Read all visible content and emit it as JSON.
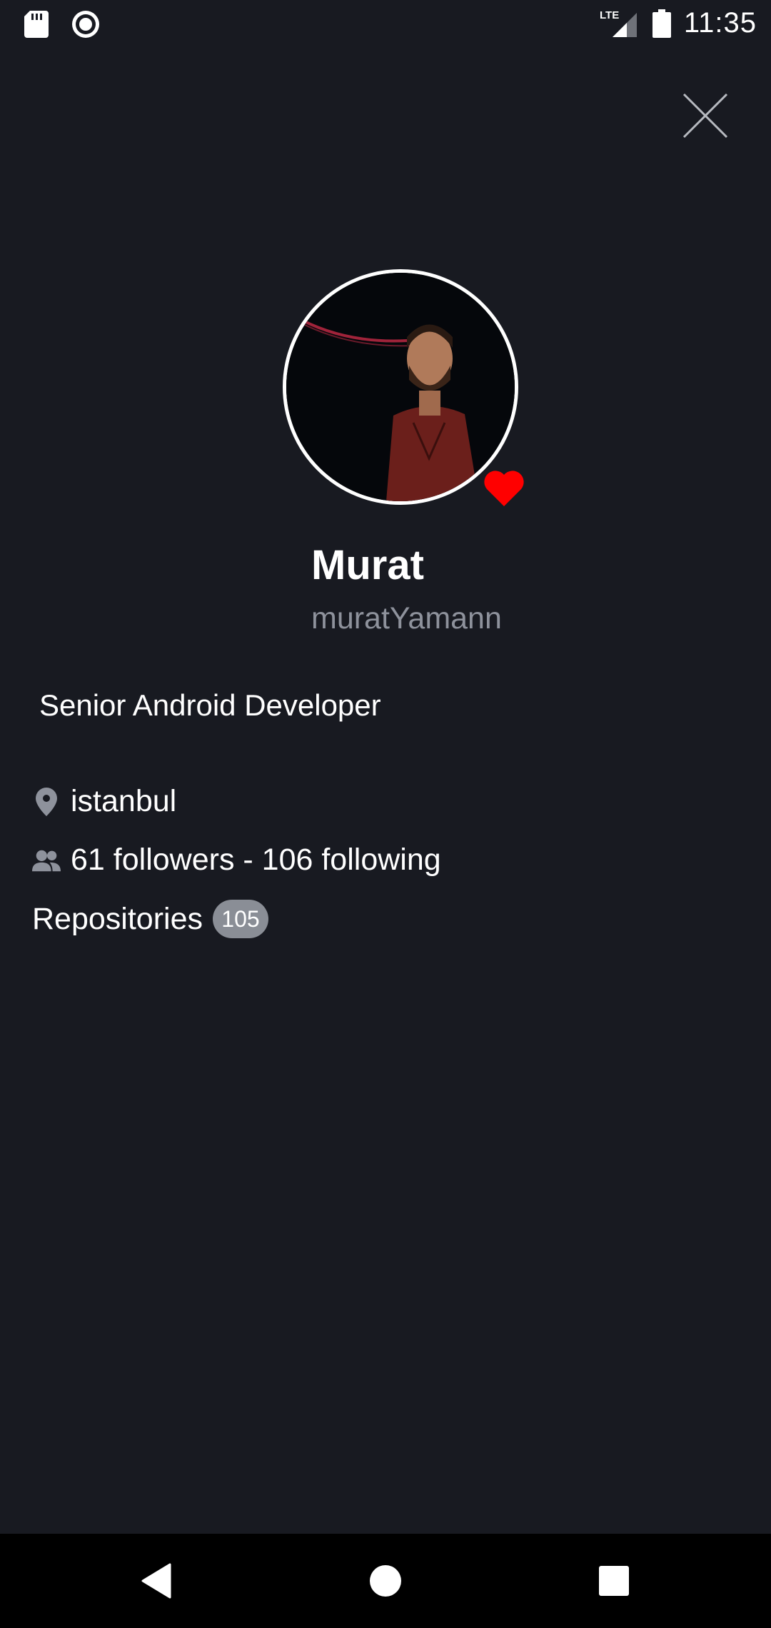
{
  "status_bar": {
    "time": "11:35",
    "network": "LTE",
    "icons": [
      "sd-card-icon",
      "record-icon",
      "lte-signal-icon",
      "battery-icon"
    ]
  },
  "profile": {
    "name": "Murat",
    "username": "muratYamann",
    "bio": "Senior Android Developer",
    "location": "istanbul",
    "follow_text": "61 followers - 106 following",
    "repositories_label": "Repositories",
    "repositories_count": "105"
  },
  "icons": {
    "close": "close-icon",
    "favorite": "heart-icon",
    "location": "location-pin-icon",
    "people": "people-icon"
  },
  "colors": {
    "background": "#181a21",
    "muted_text": "#8e929c",
    "badge": "#8a8e96",
    "heart": "#ff0000",
    "nav_bar": "#000000"
  },
  "nav_bar": {
    "buttons": [
      "back",
      "home",
      "recents"
    ]
  }
}
